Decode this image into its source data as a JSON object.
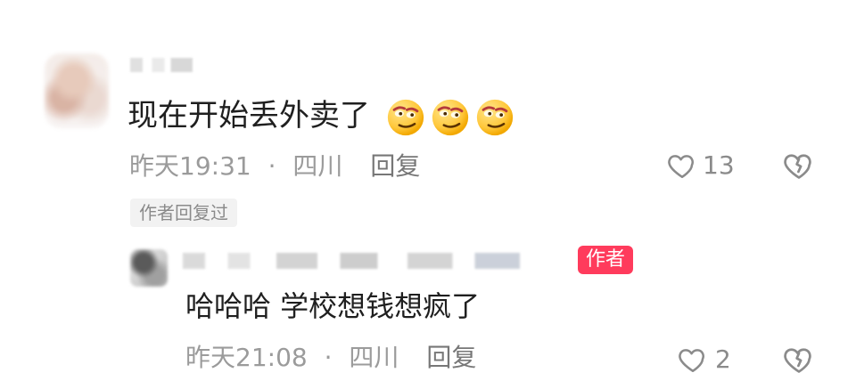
{
  "comment": {
    "text": "现在开始丢外卖了",
    "emojis": [
      "smirk-face-emoji",
      "smirk-face-emoji",
      "smirk-face-emoji"
    ],
    "time": "昨天19:31",
    "separator": "·",
    "location": "四川",
    "reply_label": "回复",
    "likes": "13",
    "author_replied_tag": "作者回复过"
  },
  "reply": {
    "author_badge": "作者",
    "text": "哈哈哈  学校想钱想疯了",
    "time": "昨天21:08",
    "separator": "·",
    "location": "四川",
    "reply_label": "回复",
    "likes": "2"
  },
  "colors": {
    "accent_badge": "#ff3b5c",
    "muted_text": "#9b9b9b"
  }
}
